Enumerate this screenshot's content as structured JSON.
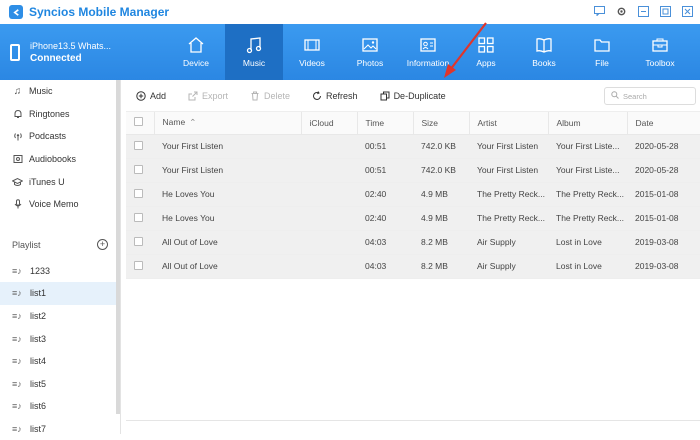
{
  "app": {
    "title": "Syncios Mobile Manager"
  },
  "device": {
    "name": "iPhone13.5 Whats...",
    "status": "Connected"
  },
  "tabs": [
    {
      "label": "Device",
      "icon": "home-icon"
    },
    {
      "label": "Music",
      "icon": "music-icon"
    },
    {
      "label": "Videos",
      "icon": "video-icon"
    },
    {
      "label": "Photos",
      "icon": "photo-icon"
    },
    {
      "label": "Information",
      "icon": "contact-icon"
    },
    {
      "label": "Apps",
      "icon": "apps-icon"
    },
    {
      "label": "Books",
      "icon": "book-icon"
    },
    {
      "label": "File",
      "icon": "folder-icon"
    },
    {
      "label": "Toolbox",
      "icon": "toolbox-icon"
    }
  ],
  "sidebar": {
    "items": [
      {
        "label": "Music"
      },
      {
        "label": "Ringtones"
      },
      {
        "label": "Podcasts"
      },
      {
        "label": "Audiobooks"
      },
      {
        "label": "iTunes U"
      },
      {
        "label": "Voice Memo"
      }
    ],
    "playlist_label": "Playlist",
    "playlists": [
      {
        "label": "1233"
      },
      {
        "label": "list1"
      },
      {
        "label": "list2"
      },
      {
        "label": "list3"
      },
      {
        "label": "list4"
      },
      {
        "label": "list5"
      },
      {
        "label": "list6"
      },
      {
        "label": "list7"
      }
    ]
  },
  "toolbar": {
    "add": "Add",
    "export": "Export",
    "delete": "Delete",
    "refresh": "Refresh",
    "dedup": "De-Duplicate",
    "search_placeholder": "Search"
  },
  "table": {
    "headers": [
      "Name",
      "iCloud",
      "Time",
      "Size",
      "Artist",
      "Album",
      "Date"
    ],
    "rows": [
      [
        "Your First Listen",
        "",
        "00:51",
        "742.0 KB",
        "Your First Listen",
        "Your First Liste...",
        "2020-05-28"
      ],
      [
        "Your First Listen",
        "",
        "00:51",
        "742.0 KB",
        "Your First Listen",
        "Your First Liste...",
        "2020-05-28"
      ],
      [
        "He Loves You",
        "",
        "02:40",
        "4.9 MB",
        "The Pretty Reck...",
        "The Pretty Reck...",
        "2015-01-08"
      ],
      [
        "He Loves You",
        "",
        "02:40",
        "4.9 MB",
        "The Pretty Reck...",
        "The Pretty Reck...",
        "2015-01-08"
      ],
      [
        "All Out of Love",
        "",
        "04:03",
        "8.2 MB",
        "Air Supply",
        "Lost in Love",
        "2019-03-08"
      ],
      [
        "All Out of Love",
        "",
        "04:03",
        "8.2 MB",
        "Air Supply",
        "Lost in Love",
        "2019-03-08"
      ]
    ]
  },
  "colors": {
    "accent": "#2b87e3",
    "active_tab": "#1e6fc4",
    "arrow": "#e0352b"
  }
}
